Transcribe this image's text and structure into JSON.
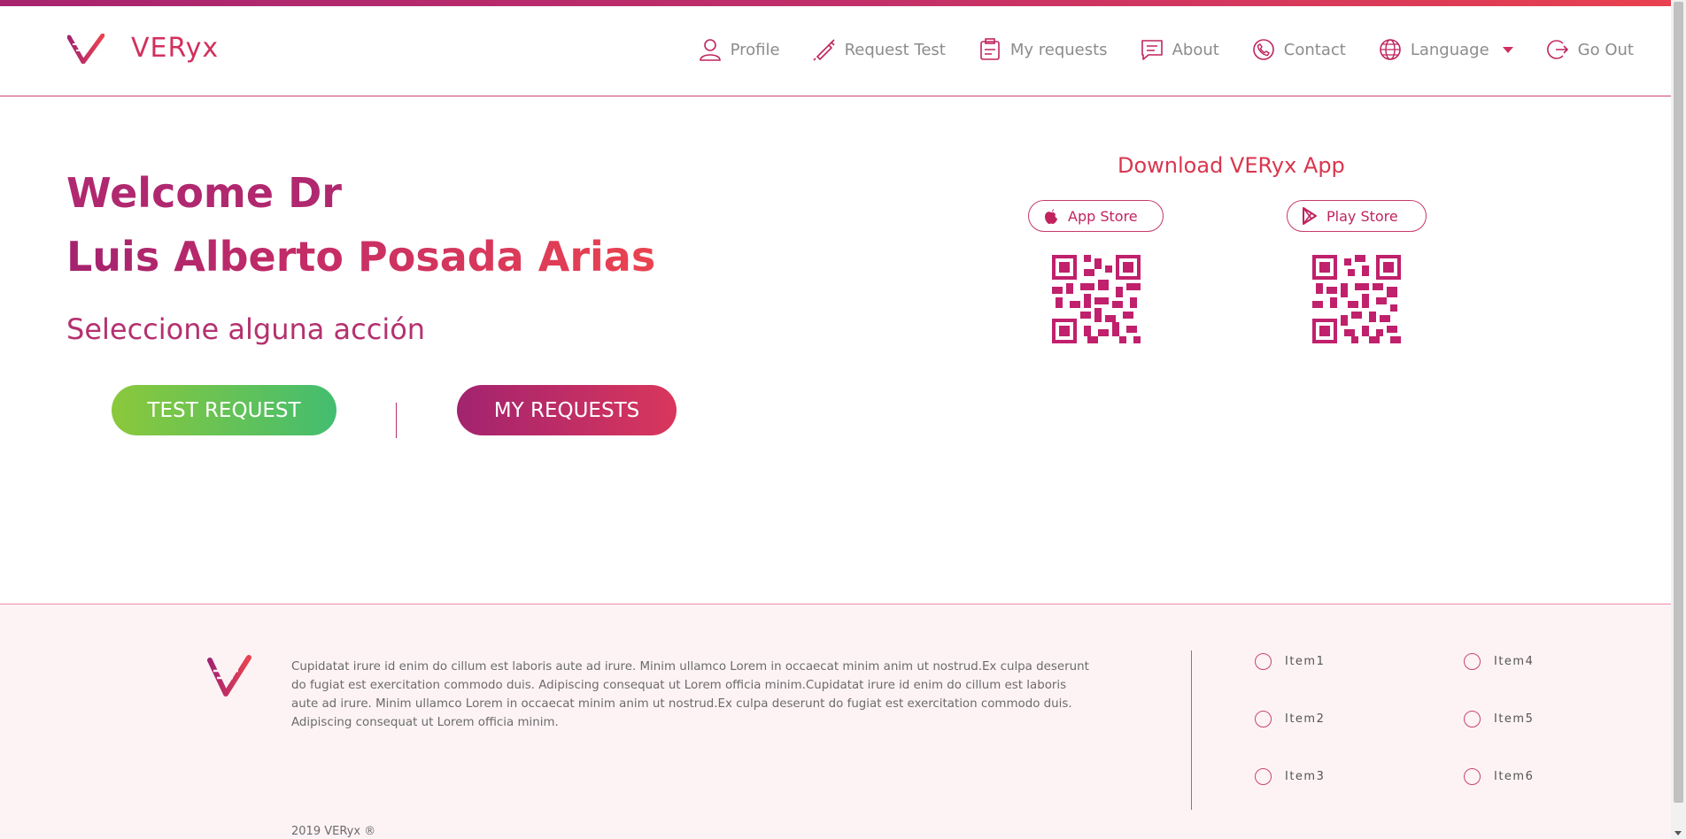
{
  "app": {
    "brand": "VERyx"
  },
  "nav": {
    "items": [
      {
        "label": "Profile",
        "icon": "user-icon"
      },
      {
        "label": "Request Test",
        "icon": "syringe-icon"
      },
      {
        "label": "My requests",
        "icon": "clipboard-icon"
      },
      {
        "label": "About",
        "icon": "chat-icon"
      },
      {
        "label": "Contact",
        "icon": "phone-icon"
      },
      {
        "label": "Language",
        "icon": "globe-icon"
      },
      {
        "label": "Go Out",
        "icon": "logout-icon"
      }
    ]
  },
  "welcome": {
    "line1": "Welcome Dr",
    "line2": "Luis Alberto Posada Arias",
    "subtitle": "Seleccione alguna acción"
  },
  "actions": {
    "test_request": "TEST REQUEST",
    "my_requests": "MY REQUESTS"
  },
  "download": {
    "title": "Download VERyx App",
    "app_store": "App Store",
    "play_store": "Play Store"
  },
  "footer": {
    "text": "Cupidatat irure id enim do cillum est laboris aute ad irure. Minim ullamco Lorem in occaecat minim anim ut nostrud.Ex culpa deserunt do fugiat est exercitation commodo duis. Adipiscing consequat ut Lorem officia minim.Cupidatat irure id enim do cillum est laboris aute ad irure. Minim ullamco Lorem in occaecat minim anim ut nostrud.Ex culpa deserunt do fugiat est exercitation commodo duis. Adipiscing consequat ut Lorem officia minim.",
    "items": [
      "Item1",
      "Item2",
      "Item3",
      "Item4",
      "Item5",
      "Item6"
    ],
    "copyright": "2019 VERyx ®"
  },
  "colors": {
    "accent": "#d2305d",
    "purple": "#a3236f",
    "green": "#8bc83b",
    "teal": "#43bd70"
  }
}
